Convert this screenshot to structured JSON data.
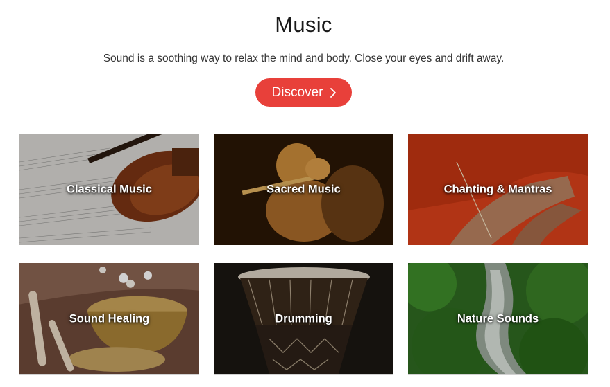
{
  "header": {
    "title": "Music",
    "subtitle": "Sound is a soothing way to relax the mind and body. Close your eyes and drift away.",
    "discover_label": "Discover",
    "discover_icon": "chevron-right-icon",
    "accent_color": "#e8403a"
  },
  "categories": [
    {
      "label": "Classical Music"
    },
    {
      "label": "Sacred Music"
    },
    {
      "label": "Chanting & Mantras"
    },
    {
      "label": "Sound Healing"
    },
    {
      "label": "Drumming"
    },
    {
      "label": "Nature Sounds"
    }
  ]
}
